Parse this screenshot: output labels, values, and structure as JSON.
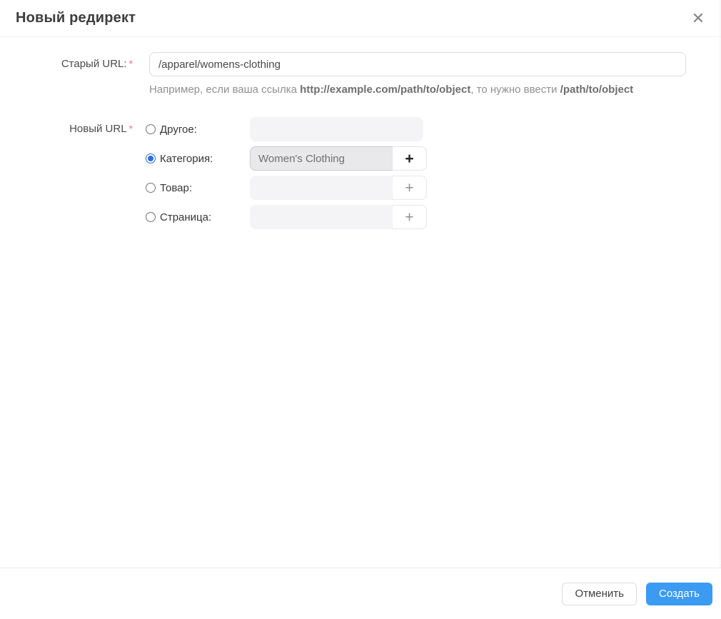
{
  "modal": {
    "title": "Новый редирект"
  },
  "icons": {
    "close": "✕",
    "plus": "+"
  },
  "colors": {
    "accent_blue": "#3b9bf3",
    "radio_checked_blue": "#2b6de0",
    "required_red": "#f4726e"
  },
  "form": {
    "old_url": {
      "label": "Старый URL:",
      "required_mark": "*",
      "value": "/apparel/womens-clothing",
      "hint_prefix": "Например, если ваша ссылка ",
      "hint_url_bold": "http://example.com/path/to/object",
      "hint_middle": ", то нужно ввести ",
      "hint_path_bold": "/path/to/object"
    },
    "new_url": {
      "label": "Новый URL",
      "required_mark": "*",
      "options": [
        {
          "label": "Другое:",
          "checked": false,
          "value": "",
          "has_plus": false
        },
        {
          "label": "Категория:",
          "checked": true,
          "value": "Women's Clothing",
          "has_plus": true
        },
        {
          "label": "Товар:",
          "checked": false,
          "value": "",
          "has_plus": true
        },
        {
          "label": "Страница:",
          "checked": false,
          "value": "",
          "has_plus": true
        }
      ]
    }
  },
  "footer": {
    "cancel_label": "Отменить",
    "create_label": "Создать"
  }
}
